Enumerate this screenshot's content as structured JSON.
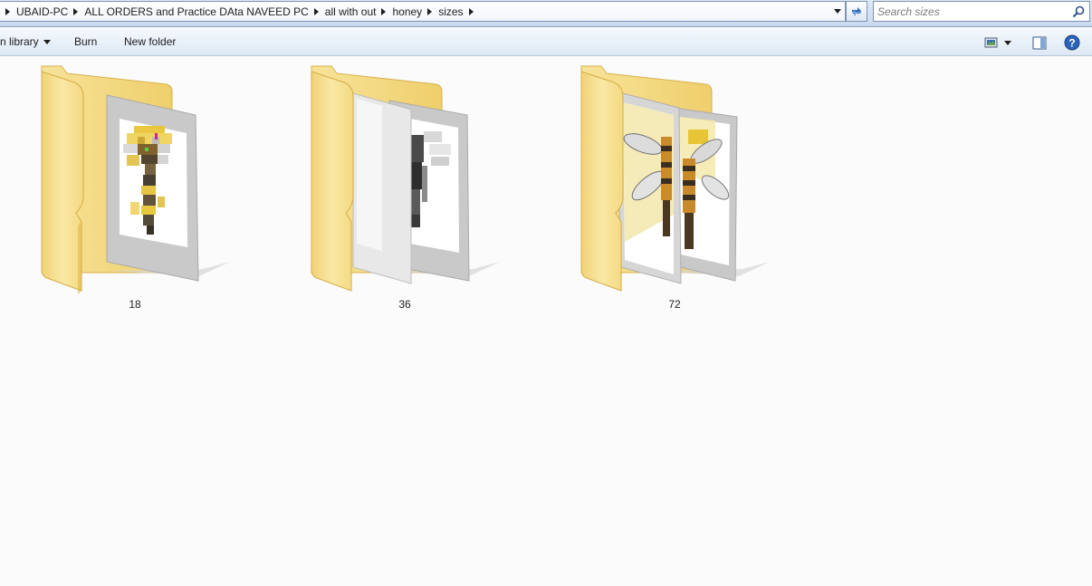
{
  "address_bar": {
    "breadcrumbs": [
      "UBAID-PC",
      "ALL ORDERS and Practice DAta NAVEED PC",
      "all with out",
      "honey",
      "sizes"
    ]
  },
  "search": {
    "placeholder": "Search sizes"
  },
  "icons": {
    "refresh": "refresh-icon",
    "search": "search-icon",
    "views": "change-view-icon",
    "preview_pane": "preview-pane-icon",
    "help": "help-icon"
  },
  "command_bar": {
    "include_library": "n library",
    "burn": "Burn",
    "new_folder": "New folder"
  },
  "folders": [
    {
      "name": "18"
    },
    {
      "name": "36"
    },
    {
      "name": "72"
    }
  ],
  "colors": {
    "folder_yellow": "#f3d776",
    "folder_shade": "#e2b94a",
    "bee_yellow": "#e8c536",
    "bee_dark": "#3a2e20",
    "accent_blue": "#2a6dbf"
  }
}
